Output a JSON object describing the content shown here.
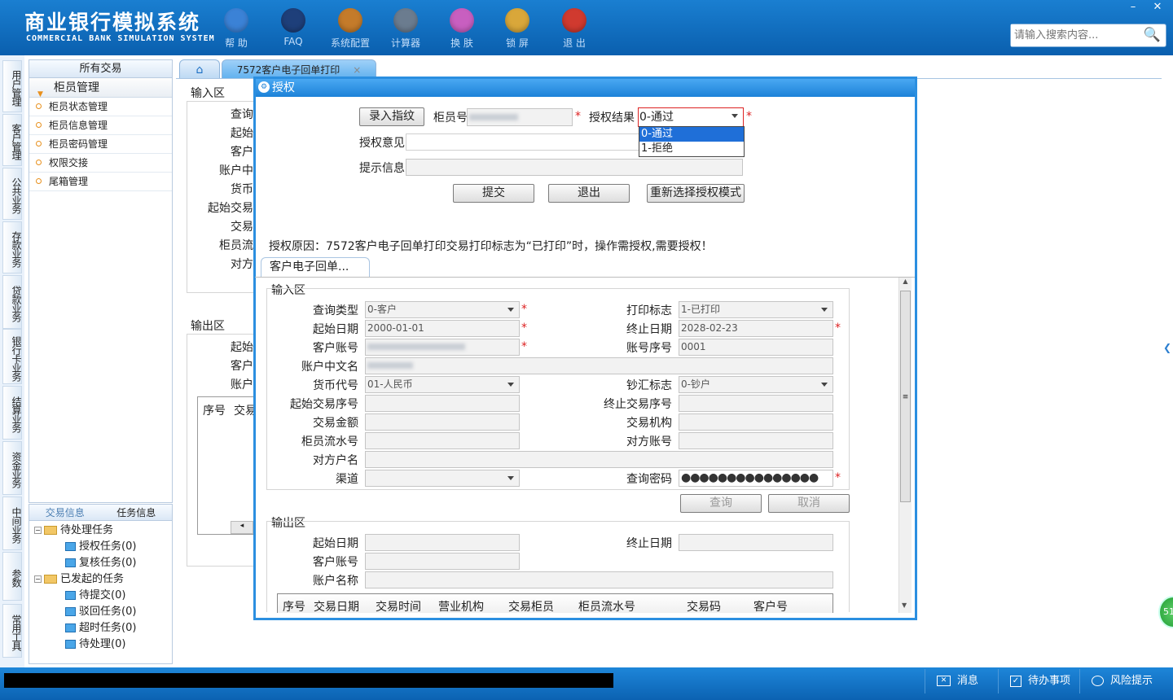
{
  "app": {
    "title_cn": "商业银行模拟系统",
    "title_en": "COMMERCIAL BANK SIMULATION SYSTEM"
  },
  "toolbar": [
    {
      "label": "帮 助",
      "icon": "info-icon",
      "color": "#3b82d6"
    },
    {
      "label": "FAQ",
      "icon": "question-icon",
      "color": "#1e3f7a"
    },
    {
      "label": "系统配置",
      "icon": "toolbox-icon",
      "color": "#c47b2a"
    },
    {
      "label": "计算器",
      "icon": "calculator-icon",
      "color": "#6b7c8f"
    },
    {
      "label": "换 肤",
      "icon": "shirt-icon",
      "color": "#c85fc0"
    },
    {
      "label": "锁 屏",
      "icon": "lock-icon",
      "color": "#d9a73a"
    },
    {
      "label": "退 出",
      "icon": "power-icon",
      "color": "#d03a2f"
    }
  ],
  "window": {
    "minimize": "–",
    "close": "✕"
  },
  "search": {
    "placeholder": "请输入搜索内容..."
  },
  "left_nav": [
    "用户管理",
    "客户管理",
    "公共业务",
    "存款业务",
    "贷款业务",
    "银行卡业务",
    "结算业务",
    "资金业务",
    "中间业务",
    "参数",
    "常用工具"
  ],
  "tree": {
    "header": "所有交易",
    "group": "柜员管理",
    "items": [
      "柜员状态管理",
      "柜员信息管理",
      "柜员密码管理",
      "权限交接",
      "尾箱管理"
    ]
  },
  "tasks": {
    "tab1": "交易信息",
    "tab2": "任务信息",
    "pending": "待处理任务",
    "pending_items": [
      "授权任务(0)",
      "复核任务(0)"
    ],
    "initiated": "已发起的任务",
    "initiated_items": [
      "待提交(0)",
      "驳回任务(0)",
      "超时任务(0)",
      "待处理(0)"
    ]
  },
  "tabs": {
    "active": "7572客户电子回单打印",
    "close": "×"
  },
  "bg_form": {
    "input_zone": "输入区",
    "output_zone": "输出区",
    "labels": [
      "查询",
      "起始",
      "客户",
      "账户中",
      "货币",
      "起始交易",
      "交易",
      "柜员流",
      "对方"
    ],
    "out_labels": [
      "起始",
      "客户",
      "账户"
    ],
    "table_cols": [
      "序号",
      "交易"
    ]
  },
  "modal": {
    "title": "授权",
    "fingerprint_btn": "录入指纹",
    "teller_label": "柜员号",
    "result_label": "授权结果",
    "result_value": "0-通过",
    "result_options": [
      "0-通过",
      "1-拒绝"
    ],
    "opinion_label": "授权意见",
    "hint_label": "提示信息",
    "submit": "提交",
    "exit": "退出",
    "reselect": "重新选择授权模式",
    "reason": "授权原因：7572客户电子回单打印交易打印标志为“已打印”时，操作需授权,需要授权！",
    "subtab": "客户电子回单..."
  },
  "inner": {
    "input_zone": "输入区",
    "output_zone": "输出区",
    "query_type_l": "查询类型",
    "query_type_v": "0-客户",
    "print_flag_l": "打印标志",
    "print_flag_v": "1-已打印",
    "start_date_l": "起始日期",
    "start_date_v": "2000-01-01",
    "end_date_l": "终止日期",
    "end_date_v": "2028-02-23",
    "account_l": "客户账号",
    "seq_l": "账号序号",
    "seq_v": "0001",
    "name_l": "账户中文名",
    "currency_l": "货币代号",
    "currency_v": "01-人民币",
    "cash_l": "钞汇标志",
    "cash_v": "0-钞户",
    "start_seq_l": "起始交易序号",
    "end_seq_l": "终止交易序号",
    "amount_l": "交易金额",
    "org_l": "交易机构",
    "teller_seq_l": "柜员流水号",
    "peer_acct_l": "对方账号",
    "peer_name_l": "对方户名",
    "channel_l": "渠道",
    "pwd_l": "查询密码",
    "pwd_v": "●●●●●●●●●●●●●●●",
    "query_btn": "查询",
    "cancel_btn": "取消",
    "out_start_l": "起始日期",
    "out_end_l": "终止日期",
    "out_acct_l": "客户账号",
    "out_name_l": "账户名称",
    "cols": [
      "序号",
      "交易日期",
      "交易时间",
      "营业机构",
      "交易柜员",
      "柜员流水号",
      "交易码",
      "客户号"
    ]
  },
  "status": {
    "msg": "消息",
    "todo": "待办事项",
    "risk": "风险提示"
  },
  "float_badge": "51"
}
